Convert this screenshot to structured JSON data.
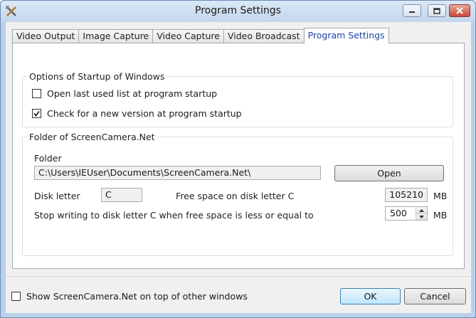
{
  "window": {
    "title": "Program Settings"
  },
  "tabs": [
    {
      "label": "Video Output",
      "active": false
    },
    {
      "label": "Image Capture",
      "active": false
    },
    {
      "label": "Video Capture",
      "active": false
    },
    {
      "label": "Video Broadcast",
      "active": false
    },
    {
      "label": "Program Settings",
      "active": true
    }
  ],
  "startup_group": {
    "title": "Options of Startup of Windows",
    "open_last_list": {
      "label": "Open last used list at program startup",
      "checked": false
    },
    "check_new_version": {
      "label": "Check for a new version at program startup",
      "checked": true
    }
  },
  "folder_group": {
    "title": "Folder of ScreenCamera.Net",
    "folder_label": "Folder",
    "folder_path": "C:\\Users\\IEUser\\Documents\\ScreenCamera.Net\\",
    "open_button": "Open",
    "disk_letter_label": "Disk letter",
    "disk_letter_value": "C",
    "free_space_label": "Free space on disk letter C",
    "free_space_value": "105210",
    "free_space_unit": "MB",
    "stop_writing_label": "Stop writing to disk letter C when free space is less or equal to",
    "stop_writing_value": "500",
    "stop_writing_unit": "MB"
  },
  "footer": {
    "on_top": {
      "label": "Show ScreenCamera.Net on top of other windows",
      "checked": false
    },
    "ok_button": "OK",
    "cancel_button": "Cancel"
  },
  "colors": {
    "title_bar": "#c3d6ec",
    "active_tab_text": "#1a44a8",
    "close_button": "#c8483a"
  }
}
